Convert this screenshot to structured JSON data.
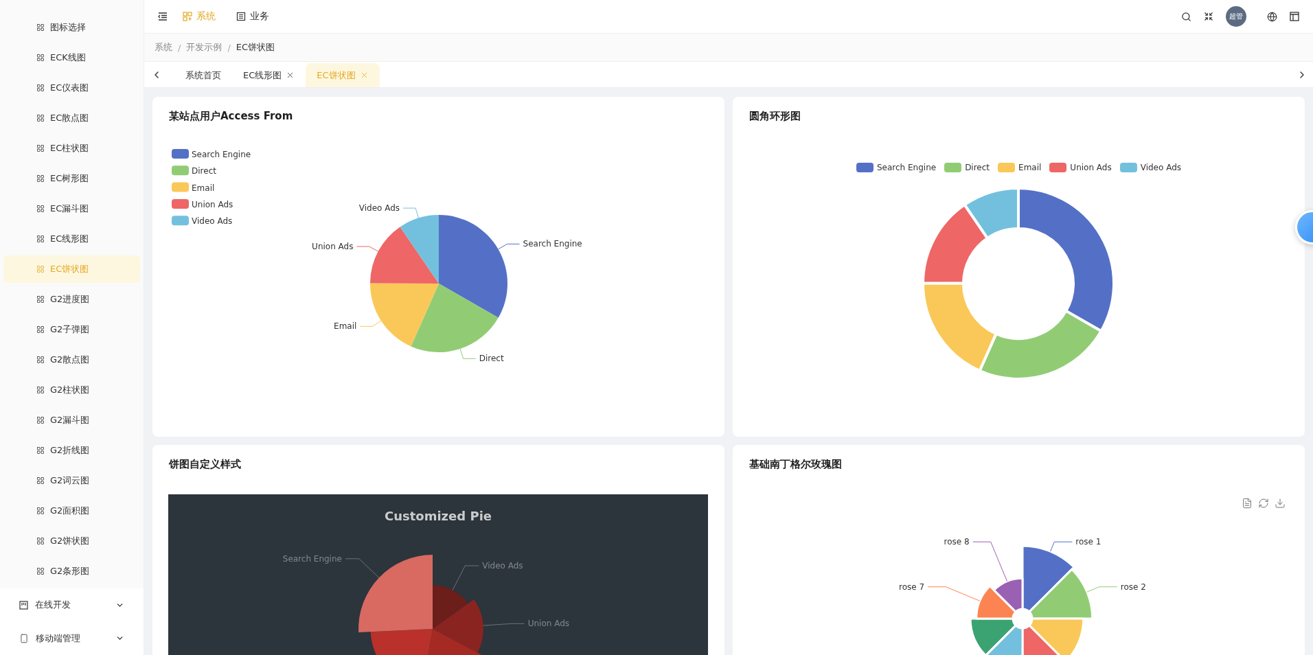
{
  "sidebar": {
    "items": [
      {
        "label": "图标选择",
        "selected": false
      },
      {
        "label": "ECK线图",
        "selected": false
      },
      {
        "label": "EC仪表图",
        "selected": false
      },
      {
        "label": "EC散点图",
        "selected": false
      },
      {
        "label": "EC柱状图",
        "selected": false
      },
      {
        "label": "EC树形图",
        "selected": false
      },
      {
        "label": "EC漏斗图",
        "selected": false
      },
      {
        "label": "EC线形图",
        "selected": false
      },
      {
        "label": "EC饼状图",
        "selected": true
      },
      {
        "label": "G2进度图",
        "selected": false
      },
      {
        "label": "G2子弹图",
        "selected": false
      },
      {
        "label": "G2散点图",
        "selected": false
      },
      {
        "label": "G2柱状图",
        "selected": false
      },
      {
        "label": "G2漏斗图",
        "selected": false
      },
      {
        "label": "G2折线图",
        "selected": false
      },
      {
        "label": "G2词云图",
        "selected": false
      },
      {
        "label": "G2面积图",
        "selected": false
      },
      {
        "label": "G2饼状图",
        "selected": false
      },
      {
        "label": "G2条形图",
        "selected": false
      }
    ],
    "groups": [
      {
        "label": "在线开发",
        "kind": "board",
        "expanded": false
      },
      {
        "label": "移动端管理",
        "kind": "phone",
        "expanded": false
      }
    ]
  },
  "header": {
    "modules": [
      {
        "label": "系统",
        "kind": "apps",
        "selected": true
      },
      {
        "label": "业务",
        "kind": "list",
        "selected": false
      }
    ],
    "avatar": "超管"
  },
  "breadcrumb": [
    "系统",
    "开发示例",
    "EC饼状图"
  ],
  "breadcrumb_separator": "/",
  "tabs": [
    {
      "label": "系统首页",
      "selected": false,
      "closable": false
    },
    {
      "label": "EC线形图",
      "selected": false,
      "closable": true
    },
    {
      "label": "EC饼状图",
      "selected": true,
      "closable": true
    }
  ],
  "cards": [
    {
      "title": "某站点用户Access From",
      "kind": "pie",
      "legend": [
        "Search Engine",
        "Direct",
        "Email",
        "Union Ads",
        "Video Ads"
      ],
      "labels": [
        "Search Engine",
        "Direct",
        "Email",
        "Union Ads",
        "Video Ads"
      ]
    },
    {
      "title": "圆角环形图",
      "kind": "donut",
      "legend": [
        "Search Engine",
        "Direct",
        "Email",
        "Union Ads",
        "Video Ads"
      ]
    },
    {
      "title": "饼图自定义样式",
      "kind": "custom",
      "chart_title": "Customized Pie",
      "labels": [
        "Video Ads",
        "Union Ads",
        "Search Engine"
      ]
    },
    {
      "title": "基础南丁格尔玫瑰图",
      "kind": "rose",
      "labels": [
        "rose 1",
        "rose 2",
        "rose 7",
        "rose 8"
      ]
    }
  ]
}
